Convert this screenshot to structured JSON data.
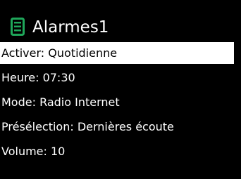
{
  "header": {
    "title": "Alarmes1",
    "icon": "list-icon",
    "icon_color": "#1fa75a"
  },
  "menu": {
    "items": [
      {
        "label": "Activer: Quotidienne",
        "selected": true
      },
      {
        "label": "Heure: 07:30",
        "selected": false
      },
      {
        "label": "Mode: Radio Internet",
        "selected": false
      },
      {
        "label": "Présélection: Dernières écoute",
        "selected": false
      },
      {
        "label": "Volume: 10",
        "selected": false
      }
    ]
  },
  "colors": {
    "background": "#000000",
    "text": "#ffffff",
    "highlight_bg": "#ffffff",
    "highlight_text": "#000000"
  }
}
